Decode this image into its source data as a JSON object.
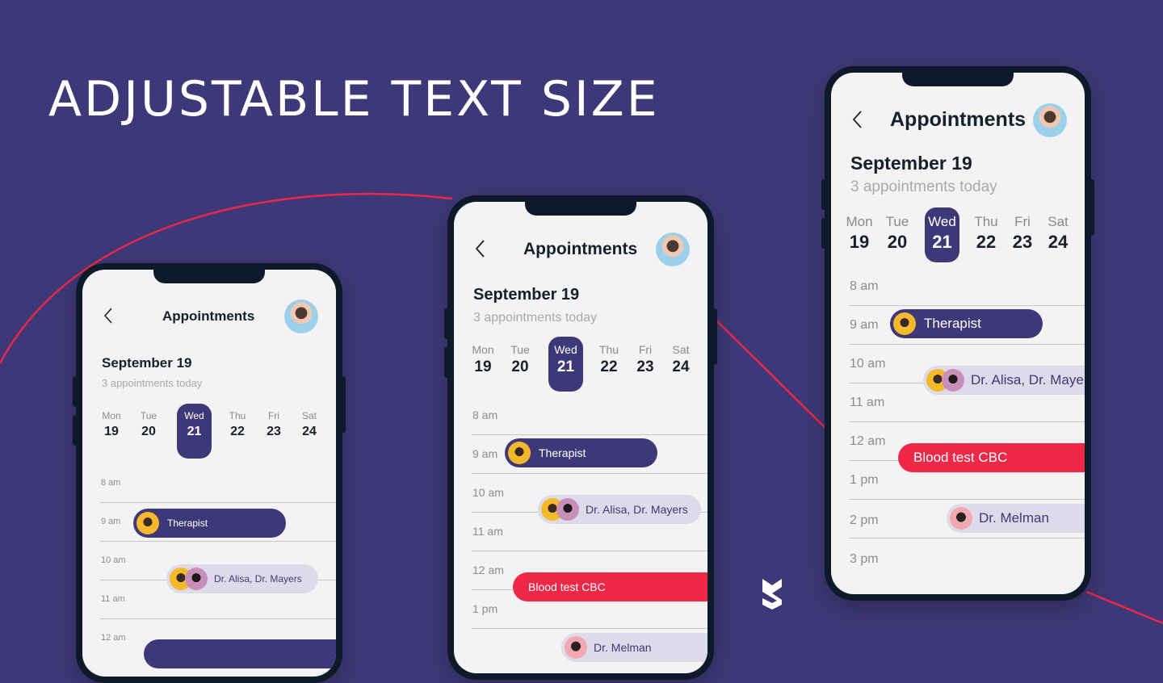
{
  "headline": "ADJUSTABLE TEXT SIZE",
  "colors": {
    "background": "#3f3878",
    "accent": "#3f3878",
    "alert": "#f02848",
    "phone_frame": "#0c1a2a",
    "screen": "#f3f3f3"
  },
  "app": {
    "title": "Appointments",
    "back_icon": "chevron-left-icon",
    "date": "September 19",
    "summary": "3 appointments today",
    "days": [
      {
        "name": "Mon",
        "num": "19"
      },
      {
        "name": "Tue",
        "num": "20"
      },
      {
        "name": "Wed",
        "num": "21",
        "selected": true
      },
      {
        "name": "Thu",
        "num": "22"
      },
      {
        "name": "Fri",
        "num": "23"
      },
      {
        "name": "Sat",
        "num": "24"
      }
    ],
    "hours": [
      "8 am",
      "9 am",
      "10 am",
      "11 am",
      "12 am",
      "1 pm",
      "2 pm",
      "3 pm"
    ],
    "events": [
      {
        "label": "Therapist",
        "style": "dark"
      },
      {
        "label": "Dr. Alisa, Dr. Mayers",
        "style": "light"
      },
      {
        "label": "Blood test CBC",
        "style": "red"
      },
      {
        "label": "Dr. Melman",
        "style": "light"
      }
    ]
  },
  "phones": [
    {
      "size": "small"
    },
    {
      "size": "medium"
    },
    {
      "size": "large"
    }
  ],
  "logo_icon": "brand-logo-icon"
}
